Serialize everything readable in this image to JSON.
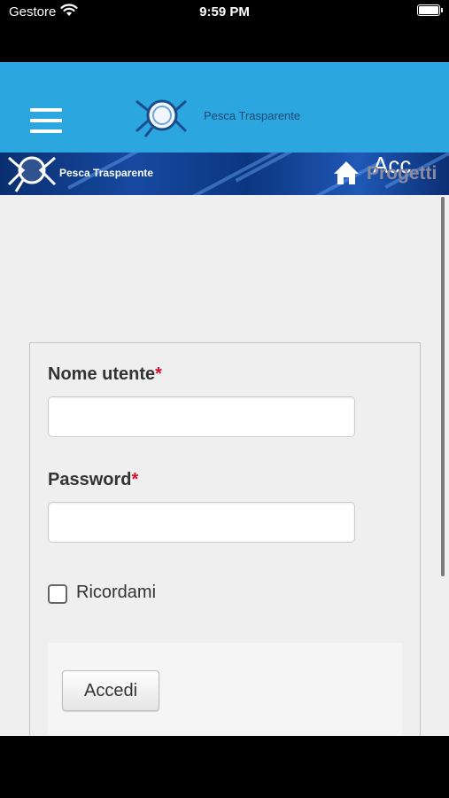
{
  "status_bar": {
    "carrier": "Gestore",
    "time": "9:59 PM"
  },
  "app_bar": {
    "title": "Pesca Trasparente"
  },
  "banner": {
    "title": "Pesca Trasparente",
    "link_overlap_top": "Acc",
    "link_overlap_bottom": "Progetti"
  },
  "login_form": {
    "username_label": "Nome utente",
    "password_label": "Password",
    "required_mark": "*",
    "remember_label": "Ricordami",
    "remember_checked": false,
    "submit_label": "Accedi"
  },
  "colors": {
    "app_bar": "#2ba6df",
    "banner": "#1649a1",
    "required": "#d6122a"
  },
  "icons": [
    "wifi-icon",
    "battery-icon",
    "menu-icon",
    "fish-logo-icon",
    "home-icon"
  ]
}
